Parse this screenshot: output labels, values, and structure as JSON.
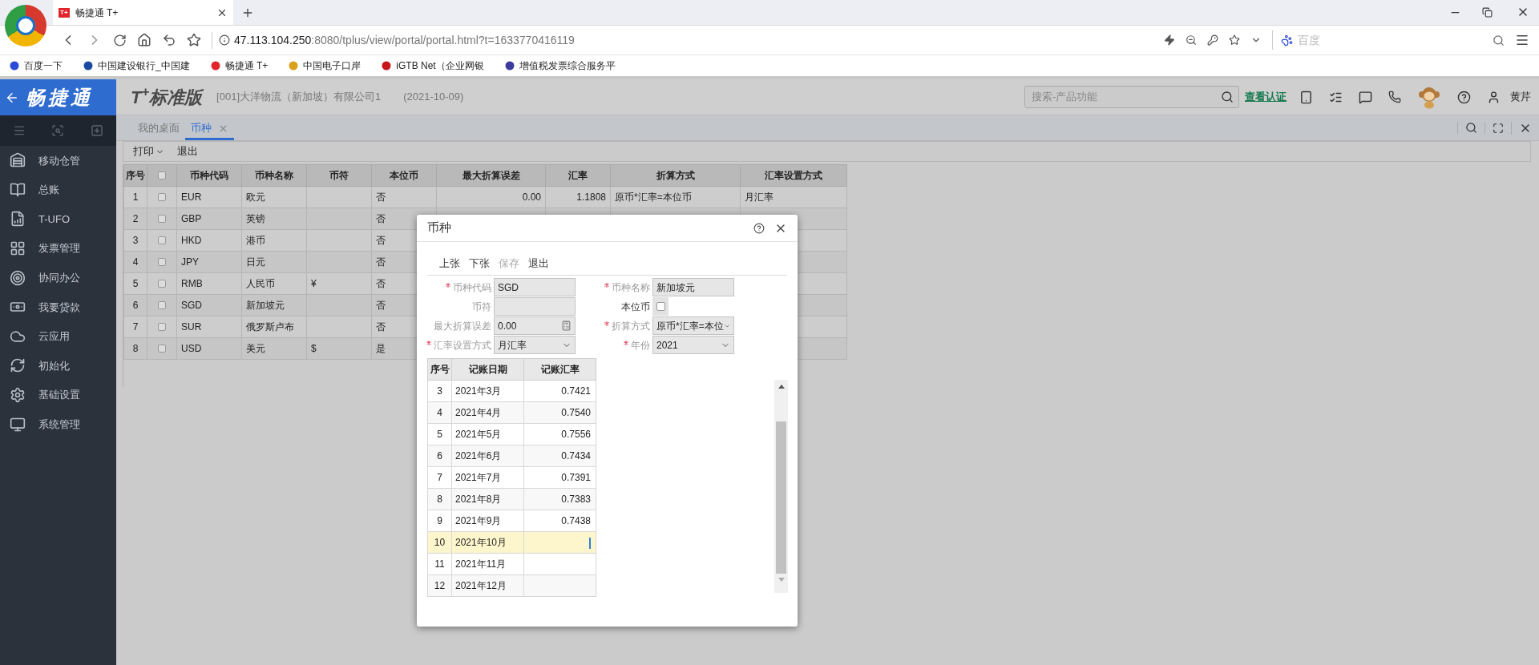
{
  "browser": {
    "tab_title": "畅捷通 T+",
    "tab_badge": "T+",
    "address_host": "47.113.104.250",
    "address_rest": ":8080/tplus/view/portal/portal.html?t=1633770416119",
    "search_placeholder": "百度",
    "bookmarks": [
      {
        "label": "百度一下"
      },
      {
        "label": "中国建设银行_中国建"
      },
      {
        "label": "畅捷通 T+"
      },
      {
        "label": "中国电子口岸"
      },
      {
        "label": "iGTB Net（企业网银"
      },
      {
        "label": "增值税发票综合服务平"
      }
    ]
  },
  "header": {
    "brand": "畅捷通",
    "product": "T$^{+}$标准版",
    "company": "[001]大洋物流（新加坡）有限公司1",
    "date": "(2021-10-09)",
    "search_placeholder": "搜索-产品功能",
    "link": "查看认证",
    "user": "黄芹"
  },
  "sidebar": {
    "items": [
      {
        "label": "移动仓管"
      },
      {
        "label": "总账"
      },
      {
        "label": "T-UFO"
      },
      {
        "label": "发票管理"
      },
      {
        "label": "协同办公"
      },
      {
        "label": "我要贷款"
      },
      {
        "label": "云应用"
      },
      {
        "label": "初始化"
      },
      {
        "label": "基础设置"
      },
      {
        "label": "系统管理"
      }
    ]
  },
  "tabs": [
    {
      "label": "我的桌面",
      "selected": false
    },
    {
      "label": "币种",
      "selected": true
    }
  ],
  "toolbar": [
    {
      "label": "打印",
      "kind": "dropdown"
    },
    {
      "label": "退出",
      "kind": "plain"
    }
  ],
  "table": {
    "select_all_checked": false,
    "columns": [
      "序号",
      "币种代码",
      "币种名称",
      "币符",
      "本位币",
      "最大折算误差",
      "汇率",
      "折算方式",
      "汇率设置方式"
    ],
    "rows": [
      {
        "no": "1",
        "checked": false,
        "code": "EUR",
        "name": "欧元",
        "base": "否",
        "max_error": "0.00",
        "rate": "1.1808",
        "method": "原币*汇率=本位币",
        "rate_mode": "月汇率"
      },
      {
        "no": "2",
        "checked": false,
        "code": "GBP",
        "name": "英镑",
        "base": "否"
      },
      {
        "no": "3",
        "checked": false,
        "code": "HKD",
        "name": "港币",
        "base": "否"
      },
      {
        "no": "4",
        "checked": false,
        "code": "JPY",
        "name": "日元",
        "base": "否"
      },
      {
        "no": "5",
        "checked": false,
        "code": "RMB",
        "name": "人民币",
        "symbol": "¥",
        "base": "否"
      },
      {
        "no": "6",
        "checked": false,
        "code": "SGD",
        "name": "新加坡元",
        "base": "否"
      },
      {
        "no": "7",
        "checked": false,
        "code": "SUR",
        "name": "俄罗斯卢布",
        "base": "否"
      },
      {
        "no": "8",
        "checked": false,
        "code": "USD",
        "name": "美元",
        "symbol": "$",
        "base": "是"
      }
    ]
  },
  "dialog": {
    "title": "币种",
    "toolbar": [
      {
        "label": "上张",
        "disabled": false
      },
      {
        "label": "下张",
        "disabled": false
      },
      {
        "label": "保存",
        "disabled": true
      },
      {
        "label": "退出",
        "disabled": false
      }
    ],
    "fields": [
      {
        "label": "币种代码",
        "required": true,
        "kind": "text",
        "value": "SGD"
      },
      {
        "label": "币种名称",
        "required": true,
        "kind": "text",
        "value": "新加坡元"
      },
      {
        "label": "币符",
        "required": false,
        "kind": "text"
      },
      {
        "label": "本位币",
        "required": false,
        "kind": "checkbox",
        "checked": false
      },
      {
        "label": "最大折算误差",
        "required": false,
        "kind": "calc",
        "value": "0.00"
      },
      {
        "label": "折算方式",
        "required": true,
        "kind": "select",
        "value": "原币*汇率=本位"
      },
      {
        "label": "汇率设置方式",
        "required": true,
        "kind": "select",
        "value": "月汇率"
      },
      {
        "label": "年份",
        "required": true,
        "kind": "select",
        "value": "2021"
      }
    ],
    "grid": {
      "columns": [
        "序号",
        "记账日期",
        "记账汇率"
      ],
      "rows": [
        {
          "no": "3",
          "date": "2021年3月",
          "rate": "0.7421",
          "selected": false
        },
        {
          "no": "4",
          "date": "2021年4月",
          "rate": "0.7540",
          "selected": false
        },
        {
          "no": "5",
          "date": "2021年5月",
          "rate": "0.7556",
          "selected": false
        },
        {
          "no": "6",
          "date": "2021年6月",
          "rate": "0.7434",
          "selected": false
        },
        {
          "no": "7",
          "date": "2021年7月",
          "rate": "0.7391",
          "selected": false
        },
        {
          "no": "8",
          "date": "2021年8月",
          "rate": "0.7383",
          "selected": false
        },
        {
          "no": "9",
          "date": "2021年9月",
          "rate": "0.7438",
          "selected": false
        },
        {
          "no": "10",
          "date": "2021年10月",
          "selected": true
        },
        {
          "no": "11",
          "date": "2021年11月",
          "selected": false
        },
        {
          "no": "12",
          "date": "2021年12月",
          "selected": false
        }
      ]
    }
  }
}
